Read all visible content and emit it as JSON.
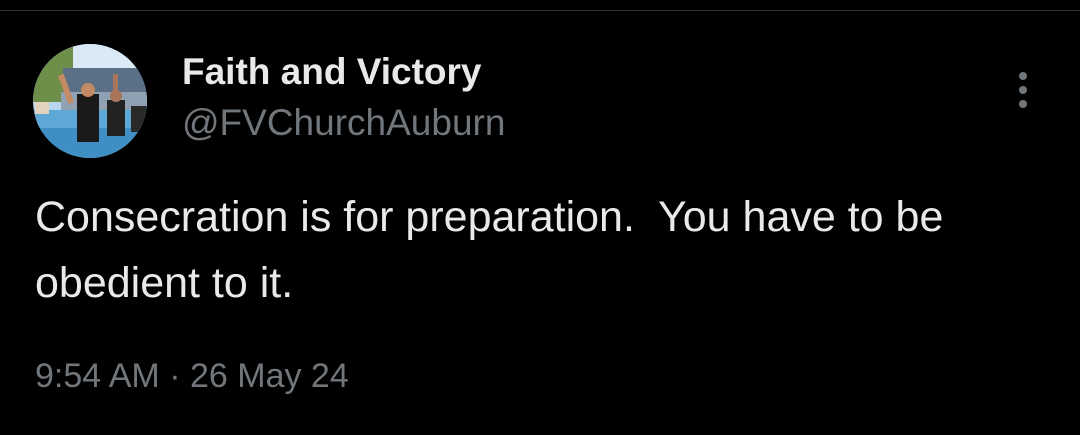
{
  "tweet": {
    "author": {
      "display_name": "Faith and Victory",
      "handle": "@FVChurchAuburn",
      "avatar_icon": "avatar-photo"
    },
    "text": "Consecration is for preparation.  You have to be obedient to it.",
    "time": "9:54 AM",
    "separator": "·",
    "date": "26 May 24",
    "more_icon": "more-vertical-icon"
  },
  "colors": {
    "background": "#000000",
    "primary_text": "#e7e9ea",
    "secondary_text": "#71767b",
    "divider": "#2f3336"
  }
}
